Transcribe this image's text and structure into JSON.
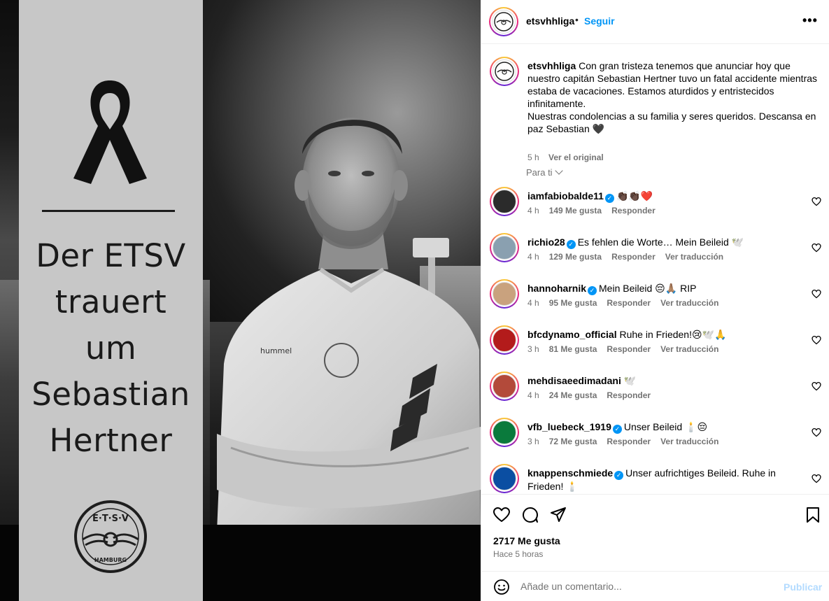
{
  "media": {
    "headline": [
      "Der ETSV",
      "trauert",
      "um",
      "Sebastian",
      "Hertner"
    ],
    "crest_text": {
      "top": "E·T·S·V",
      "bottom": "HAMBURG"
    },
    "jersey_brand": "hummel"
  },
  "post": {
    "username": "etsvhhliga",
    "separator": "•",
    "follow_label": "Seguir",
    "more_label": "•••"
  },
  "caption": {
    "username": "etsvhhliga",
    "text": "Con gran tristeza tenemos que anunciar hoy que nuestro capitán Sebastian Hertner tuvo un fatal accidente mientras estaba de vacaciones. Estamos aturdidos y entristecidos infinitamente.",
    "text2": "Nuestras condolencias a su familia y seres queridos. Descansa en paz Sebastian 🖤",
    "time": "5 h",
    "see_original": "Ver el original"
  },
  "for_you_label": "Para ti",
  "comments": [
    {
      "user": "iamfabiobalde11",
      "verified": true,
      "text": "👏🏿👏🏿❤️",
      "time": "4 h",
      "likes": "149 Me gusta",
      "reply": "Responder",
      "translate": "",
      "avatar_color": "#2b2b2b"
    },
    {
      "user": "richio28",
      "verified": true,
      "text": "Es fehlen die Worte… Mein Beileid 🕊️",
      "time": "4 h",
      "likes": "129 Me gusta",
      "reply": "Responder",
      "translate": "Ver traducción",
      "avatar_color": "#8aa0b0"
    },
    {
      "user": "hannoharnik",
      "verified": true,
      "text": "Mein Beileid 😔🙏🏽 RIP",
      "time": "4 h",
      "likes": "95 Me gusta",
      "reply": "Responder",
      "translate": "Ver traducción",
      "avatar_color": "#c9a27e"
    },
    {
      "user": "bfcdynamo_official",
      "verified": false,
      "text": "Ruhe in Frieden!😢🕊️🙏",
      "time": "3 h",
      "likes": "81 Me gusta",
      "reply": "Responder",
      "translate": "Ver traducción",
      "avatar_color": "#b31b1b"
    },
    {
      "user": "mehdisaeedimadani",
      "verified": false,
      "text": "🕊️",
      "time": "4 h",
      "likes": "24 Me gusta",
      "reply": "Responder",
      "translate": "",
      "avatar_color": "#b34a3a"
    },
    {
      "user": "vfb_luebeck_1919",
      "verified": true,
      "text": "Unser Beileid 🕯️😔",
      "time": "3 h",
      "likes": "72 Me gusta",
      "reply": "Responder",
      "translate": "Ver traducción",
      "avatar_color": "#0a7a3c"
    },
    {
      "user": "knappenschmiede",
      "verified": true,
      "text": "Unser aufrichtiges Beileid. Ruhe in Frieden! 🕯️",
      "time": "",
      "likes": "",
      "reply": "",
      "translate": "",
      "avatar_color": "#0b4ea2"
    }
  ],
  "actions": {
    "likes": "2717 Me gusta",
    "ago": "Hace 5 horas"
  },
  "composer": {
    "placeholder": "Añade un comentario...",
    "publish": "Publicar"
  },
  "colors": {
    "accent": "#0095f6",
    "publish_disabled": "#b3dbff",
    "muted": "#737373"
  }
}
